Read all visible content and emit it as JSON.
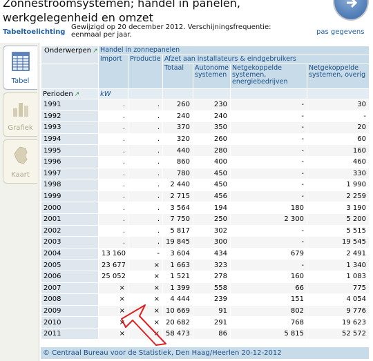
{
  "header": {
    "title": "Zonnestroomsystemen; handel in panelen, werkgelegenheid en omzet",
    "tab_explain": "Tabeltoelichting",
    "changed": "Gewijzigd op 20 december 2012. Verschijningsfrequentie: eenmaal per jaar.",
    "pas_gegevens": "pas gegevens"
  },
  "sidebar": {
    "tabs": [
      {
        "label": "Tabel",
        "icon": "table-icon"
      },
      {
        "label": "Grafiek",
        "icon": "chart-icon"
      },
      {
        "label": "Kaart",
        "icon": "map-icon"
      }
    ]
  },
  "table": {
    "onderwerpen": "Onderwerpen",
    "handel": "Handel in zonnepanelen",
    "import": "Import",
    "productie": "Productie",
    "afzet": "Afzet aan installateurs & eindgebruikers",
    "totaal": "Totaal",
    "autonome": "Autonome systemen",
    "netgek_energie": "Netgekoppelde systemen, energiebedrijven",
    "netgek_overig": "Netgekoppelde systemen, overig",
    "perioden": "Perioden",
    "unit": "kW",
    "rows": [
      {
        "year": "1991",
        "cells": [
          ".",
          ".",
          "260",
          "230",
          "-",
          "30"
        ]
      },
      {
        "year": "1992",
        "cells": [
          ".",
          ".",
          "240",
          "240",
          "-",
          "-"
        ]
      },
      {
        "year": "1993",
        "cells": [
          ".",
          ".",
          "370",
          "350",
          "-",
          "20"
        ]
      },
      {
        "year": "1994",
        "cells": [
          ".",
          ".",
          "320",
          "260",
          "-",
          "60"
        ]
      },
      {
        "year": "1995",
        "cells": [
          ".",
          ".",
          "440",
          "280",
          "-",
          "160"
        ]
      },
      {
        "year": "1996",
        "cells": [
          ".",
          ".",
          "860",
          "400",
          "-",
          "460"
        ]
      },
      {
        "year": "1997",
        "cells": [
          ".",
          ".",
          "780",
          "450",
          "-",
          "330"
        ]
      },
      {
        "year": "1998",
        "cells": [
          ".",
          ".",
          "2 440",
          "450",
          "-",
          "1 990"
        ]
      },
      {
        "year": "1999",
        "cells": [
          ".",
          ".",
          "2 715",
          "456",
          "-",
          "2 259"
        ]
      },
      {
        "year": "2000",
        "cells": [
          ".",
          ".",
          "3 564",
          "194",
          "180",
          "3 190"
        ]
      },
      {
        "year": "2001",
        "cells": [
          ".",
          ".",
          "7 750",
          "250",
          "2 300",
          "5 200"
        ]
      },
      {
        "year": "2002",
        "cells": [
          ".",
          ".",
          "5 817",
          "302",
          "-",
          "5 515"
        ]
      },
      {
        "year": "2003",
        "cells": [
          ".",
          ".",
          "19 845",
          "300",
          "-",
          "19 545"
        ]
      },
      {
        "year": "2004",
        "cells": [
          "13 160",
          "-",
          "3 604",
          "434",
          "679",
          "2 491"
        ]
      },
      {
        "year": "2005",
        "cells": [
          "23 677",
          "×",
          "1 663",
          "323",
          "-",
          "1 340"
        ]
      },
      {
        "year": "2006",
        "cells": [
          "25 052",
          "×",
          "1 521",
          "278",
          "160",
          "1 083"
        ]
      },
      {
        "year": "2007",
        "cells": [
          "×",
          "×",
          "1 399",
          "558",
          "66",
          "775"
        ]
      },
      {
        "year": "2008",
        "cells": [
          "×",
          "×",
          "4 444",
          "239",
          "151",
          "4 054"
        ]
      },
      {
        "year": "2009",
        "cells": [
          "×",
          "×",
          "10 669",
          "91",
          "802",
          "9 776"
        ]
      },
      {
        "year": "2010",
        "cells": [
          "×",
          "×",
          "20 682",
          "291",
          "768",
          "19 623"
        ]
      },
      {
        "year": "2011",
        "cells": [
          "×",
          "×",
          "58 473",
          "86",
          "5 815",
          "52 572"
        ]
      }
    ]
  },
  "footer": "© Centraal Bureau voor de Statistiek, Den Haag/Heerlen 20-12-2012",
  "colors": {
    "header_blue": "#c8dbe8",
    "link_blue": "#1f5fa6",
    "annotation_red": "#e02020"
  }
}
